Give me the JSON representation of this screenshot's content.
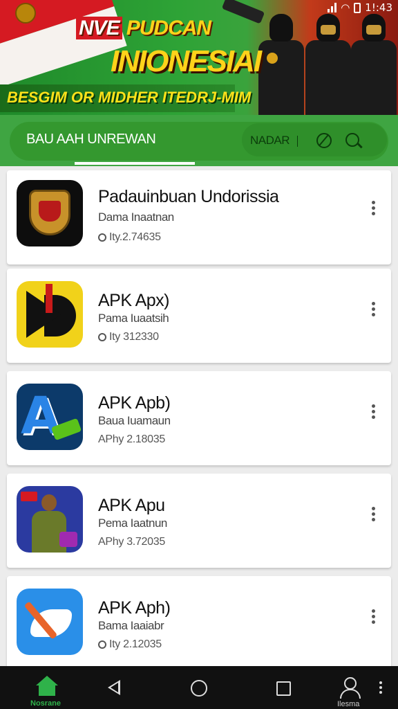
{
  "status_bar": {
    "time": "1!:43"
  },
  "banner": {
    "tag": "NVE",
    "title_line1": "PUDCAN",
    "title_line2": "INIONESIAI",
    "subtitle": "BESGIM OR MIDHER ITEDRJ-MIM"
  },
  "toolbar": {
    "tab_label": "BAU AAH UNREWAN",
    "search_text": "NADAR",
    "colors": {
      "bar": "#3fa542",
      "pill": "#34982f"
    }
  },
  "apps": [
    {
      "title": "Padauinbuan Undorissia",
      "subtitle": "Dama Inaatnan",
      "meta": "Ity.2.74635",
      "icon": "garuda-emblem-icon"
    },
    {
      "title": "APK Apx)",
      "subtitle": "Pama Iuaatsih",
      "meta": "Ity 312330",
      "icon": "play-arrow-icon"
    },
    {
      "title": "APK Apb)",
      "subtitle": "Baua Iuamaun",
      "meta": "APhy 2.18035",
      "icon": "letter-a-icon"
    },
    {
      "title": "APK Apu",
      "subtitle": "Pema Iaatnun",
      "meta": "APhy 3.72035",
      "icon": "soldier-portrait-icon"
    },
    {
      "title": "APK Aph)",
      "subtitle": "Bama Iaaiabr",
      "meta": "Ity 2.12035",
      "icon": "wing-pen-icon"
    }
  ],
  "bottom_nav": {
    "home_label": "Nosrane",
    "profile_label": "Ilesma",
    "accent": "#2fb24a"
  }
}
